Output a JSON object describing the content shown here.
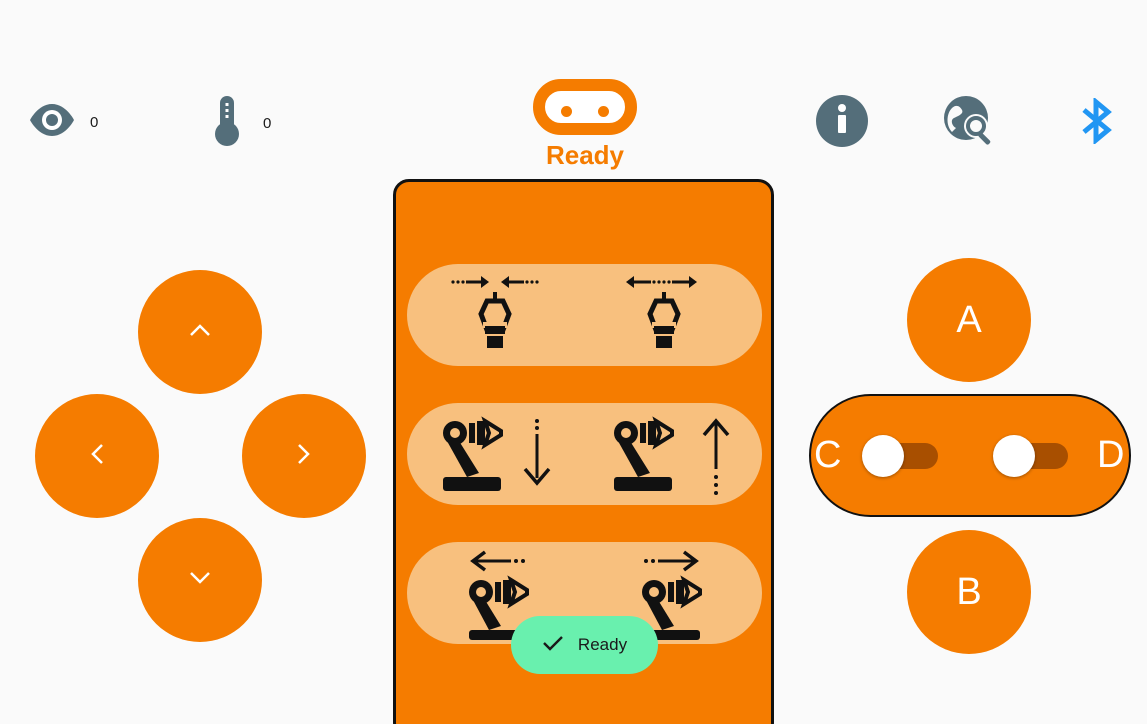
{
  "colors": {
    "accent": "#f57c00",
    "accent_light": "#f8c07e",
    "icon_gray": "#546e7a",
    "bluetooth": "#2196f3",
    "toast_green": "#69f0ae"
  },
  "header": {
    "light_value": "0",
    "temperature_value": "0",
    "status_title": "Ready",
    "icons": [
      "eye-icon",
      "thermometer-icon",
      "microbit-logo",
      "info-icon",
      "search-device-icon",
      "bluetooth-icon"
    ]
  },
  "dpad": {
    "up_icon": "chevron-up-icon",
    "left_icon": "chevron-left-icon",
    "right_icon": "chevron-right-icon",
    "down_icon": "chevron-down-icon"
  },
  "actions": {
    "rows": [
      {
        "left": "gripper-close-icon",
        "right": "gripper-open-icon"
      },
      {
        "left": "arm-down-icon",
        "right": "arm-up-icon"
      },
      {
        "left": "arm-left-icon",
        "right": "arm-right-icon"
      }
    ]
  },
  "buttons": {
    "a_label": "A",
    "b_label": "B",
    "c_label": "C",
    "d_label": "D",
    "c_toggle_on": false,
    "d_toggle_on": false
  },
  "toast": {
    "icon": "check-icon",
    "message": "Ready"
  }
}
